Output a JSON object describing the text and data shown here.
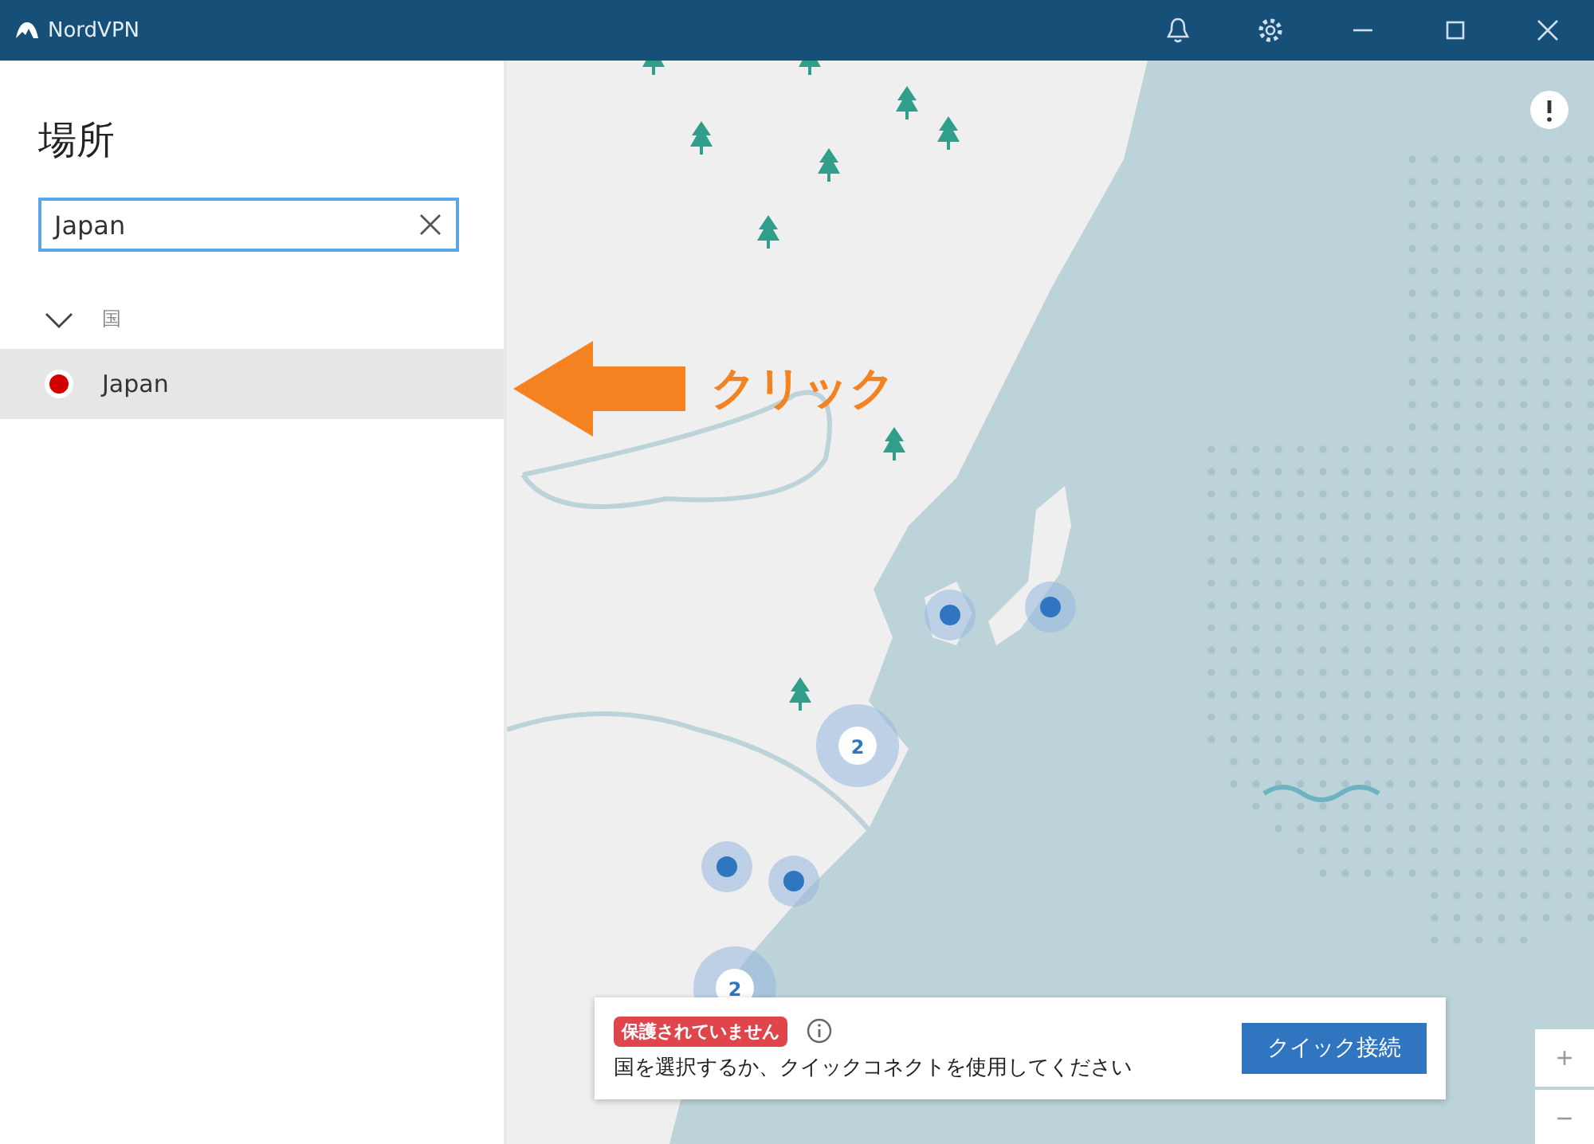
{
  "window": {
    "title": "NordVPN"
  },
  "sidebar": {
    "heading": "場所",
    "search": {
      "value": "Japan"
    },
    "groups": [
      {
        "label": "国",
        "expanded": true,
        "items": [
          {
            "name": "Japan",
            "selected": true,
            "color": "#d20000"
          }
        ]
      }
    ]
  },
  "map": {
    "cluster_labels": [
      "2",
      "2"
    ]
  },
  "annotation": {
    "text": "クリック"
  },
  "status_card": {
    "badge": "保護されていません",
    "message": "国を選択するか、クイックコネクトを使用してください",
    "button": "クイック接続"
  },
  "zoom_controls": [
    "+",
    "−"
  ]
}
